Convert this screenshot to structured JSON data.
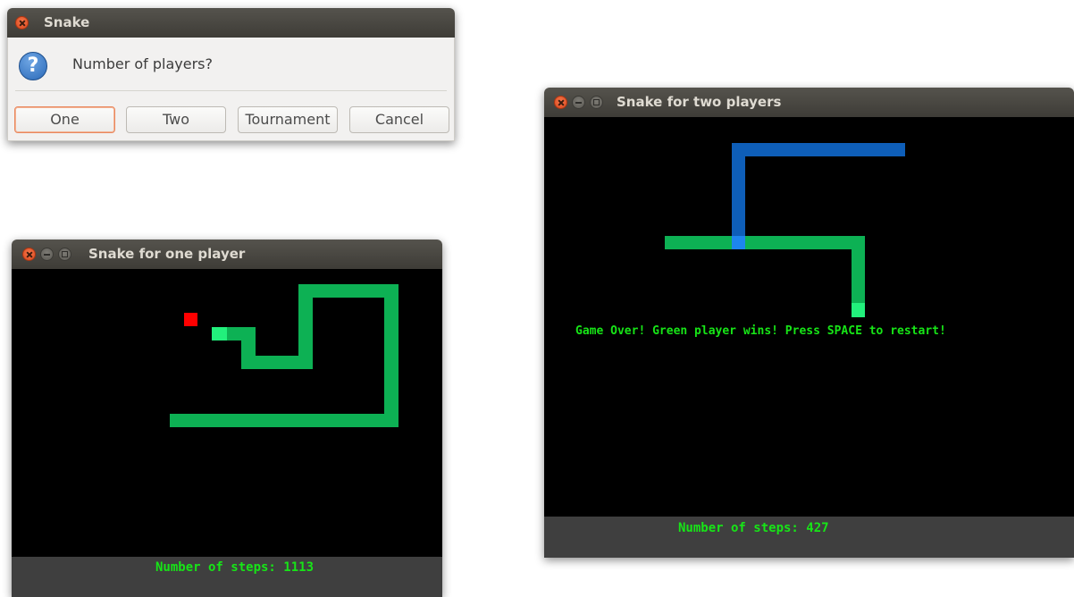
{
  "dialog": {
    "title": "Snake",
    "icon": "question-icon",
    "icon_glyph": "?",
    "question": "Number of players?",
    "buttons": {
      "one": "One",
      "two": "Two",
      "tournament": "Tournament",
      "cancel": "Cancel"
    }
  },
  "one_player_window": {
    "title": "Snake for one player",
    "status": "Number of steps: 1113"
  },
  "two_player_window": {
    "title": "Snake for two players",
    "message": "Game Over! Green player wins! Press SPACE to restart!",
    "status": "Number of steps: 427"
  },
  "colors": {
    "game_background": "#000000",
    "status_bar": "#3f3f3f",
    "status_text": "#17e517",
    "green_snake_body": "#0db154",
    "green_snake_head": "#22f07c",
    "blue_snake_body": "#0e5eb8",
    "blue_snake_head": "#1d86ee",
    "food": "#ff0000"
  }
}
